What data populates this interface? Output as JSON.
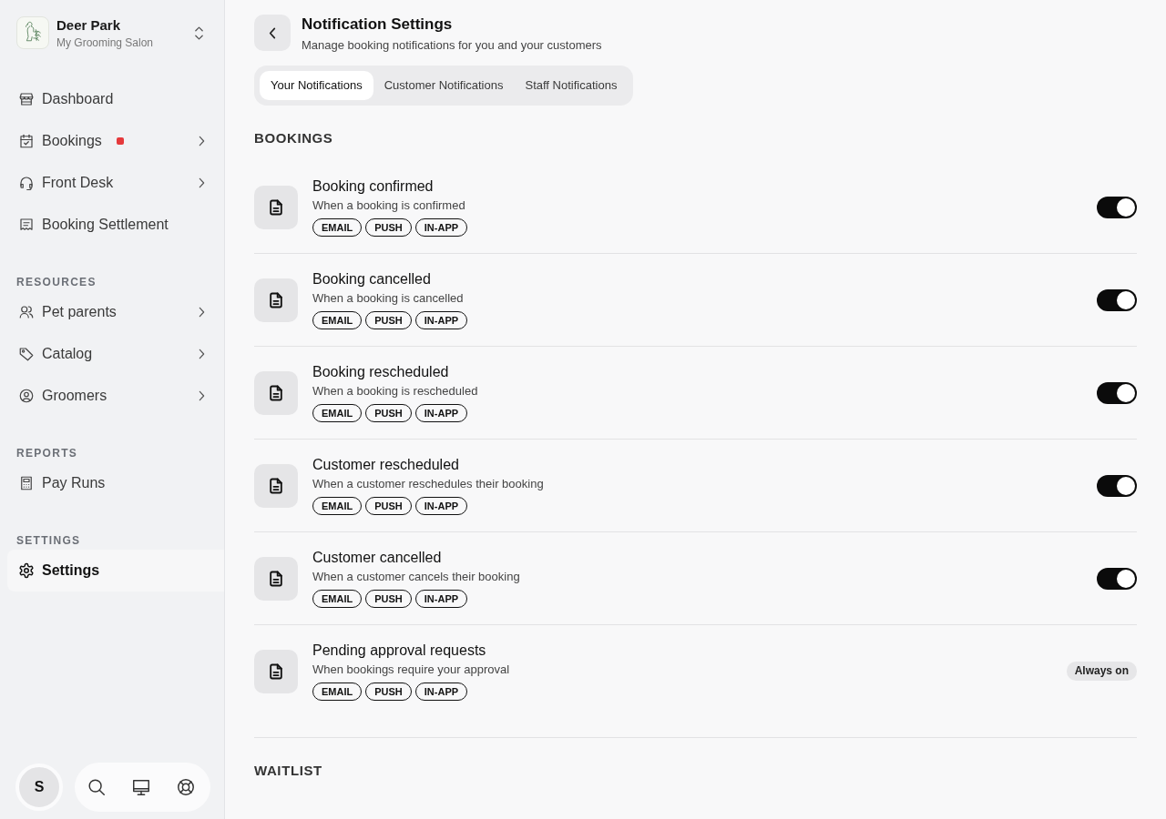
{
  "sidebar": {
    "workspace": {
      "name": "Deer Park",
      "subtitle": "My Grooming Salon"
    },
    "groups": [
      {
        "items": [
          {
            "label": "Dashboard",
            "selected": false,
            "has_submenu": false,
            "notification_dot": false
          },
          {
            "label": "Bookings",
            "selected": false,
            "has_submenu": true,
            "notification_dot": true
          },
          {
            "label": "Front Desk",
            "selected": false,
            "has_submenu": true,
            "notification_dot": false
          },
          {
            "label": "Booking Settlement",
            "selected": false,
            "has_submenu": false,
            "notification_dot": false
          }
        ]
      },
      {
        "title": "RESOURCES",
        "items": [
          {
            "label": "Pet parents",
            "selected": false,
            "has_submenu": true,
            "notification_dot": false
          },
          {
            "label": "Catalog",
            "selected": false,
            "has_submenu": true,
            "notification_dot": false
          },
          {
            "label": "Groomers",
            "selected": false,
            "has_submenu": true,
            "notification_dot": false
          }
        ]
      },
      {
        "title": "REPORTS",
        "items": [
          {
            "label": "Pay Runs",
            "selected": false,
            "has_submenu": false,
            "notification_dot": false
          }
        ]
      },
      {
        "title": "SETTINGS",
        "items": [
          {
            "label": "Settings",
            "selected": true,
            "has_submenu": false,
            "notification_dot": false
          }
        ]
      }
    ],
    "user": {
      "initial": "S"
    }
  },
  "header": {
    "title": "Notification Settings",
    "subtitle": "Manage booking notifications for you and your customers"
  },
  "tabs": [
    {
      "label": "Your Notifications",
      "selected": true
    },
    {
      "label": "Customer Notifications",
      "selected": false
    },
    {
      "label": "Staff Notifications",
      "selected": false
    }
  ],
  "sections": [
    {
      "title": "BOOKINGS",
      "rows": [
        {
          "kind": "toggle",
          "title": "Booking confirmed",
          "description": "When a booking is confirmed",
          "channels": [
            "EMAIL",
            "PUSH",
            "IN-APP"
          ],
          "on": true
        },
        {
          "kind": "toggle",
          "title": "Booking cancelled",
          "description": "When a booking is cancelled",
          "channels": [
            "EMAIL",
            "PUSH",
            "IN-APP"
          ],
          "on": true
        },
        {
          "kind": "toggle",
          "title": "Booking rescheduled",
          "description": "When a booking is rescheduled",
          "channels": [
            "EMAIL",
            "PUSH",
            "IN-APP"
          ],
          "on": true
        },
        {
          "kind": "toggle",
          "title": "Customer rescheduled",
          "description": "When a customer reschedules their booking",
          "channels": [
            "EMAIL",
            "PUSH",
            "IN-APP"
          ],
          "on": true
        },
        {
          "kind": "toggle",
          "title": "Customer cancelled",
          "description": "When a customer cancels their booking",
          "channels": [
            "EMAIL",
            "PUSH",
            "IN-APP"
          ],
          "on": true
        },
        {
          "kind": "always_on",
          "title": "Pending approval requests",
          "description": "When bookings require your approval",
          "channels": [
            "EMAIL",
            "PUSH",
            "IN-APP"
          ],
          "badge": "Always on"
        }
      ]
    },
    {
      "title": "WAITLIST"
    }
  ]
}
